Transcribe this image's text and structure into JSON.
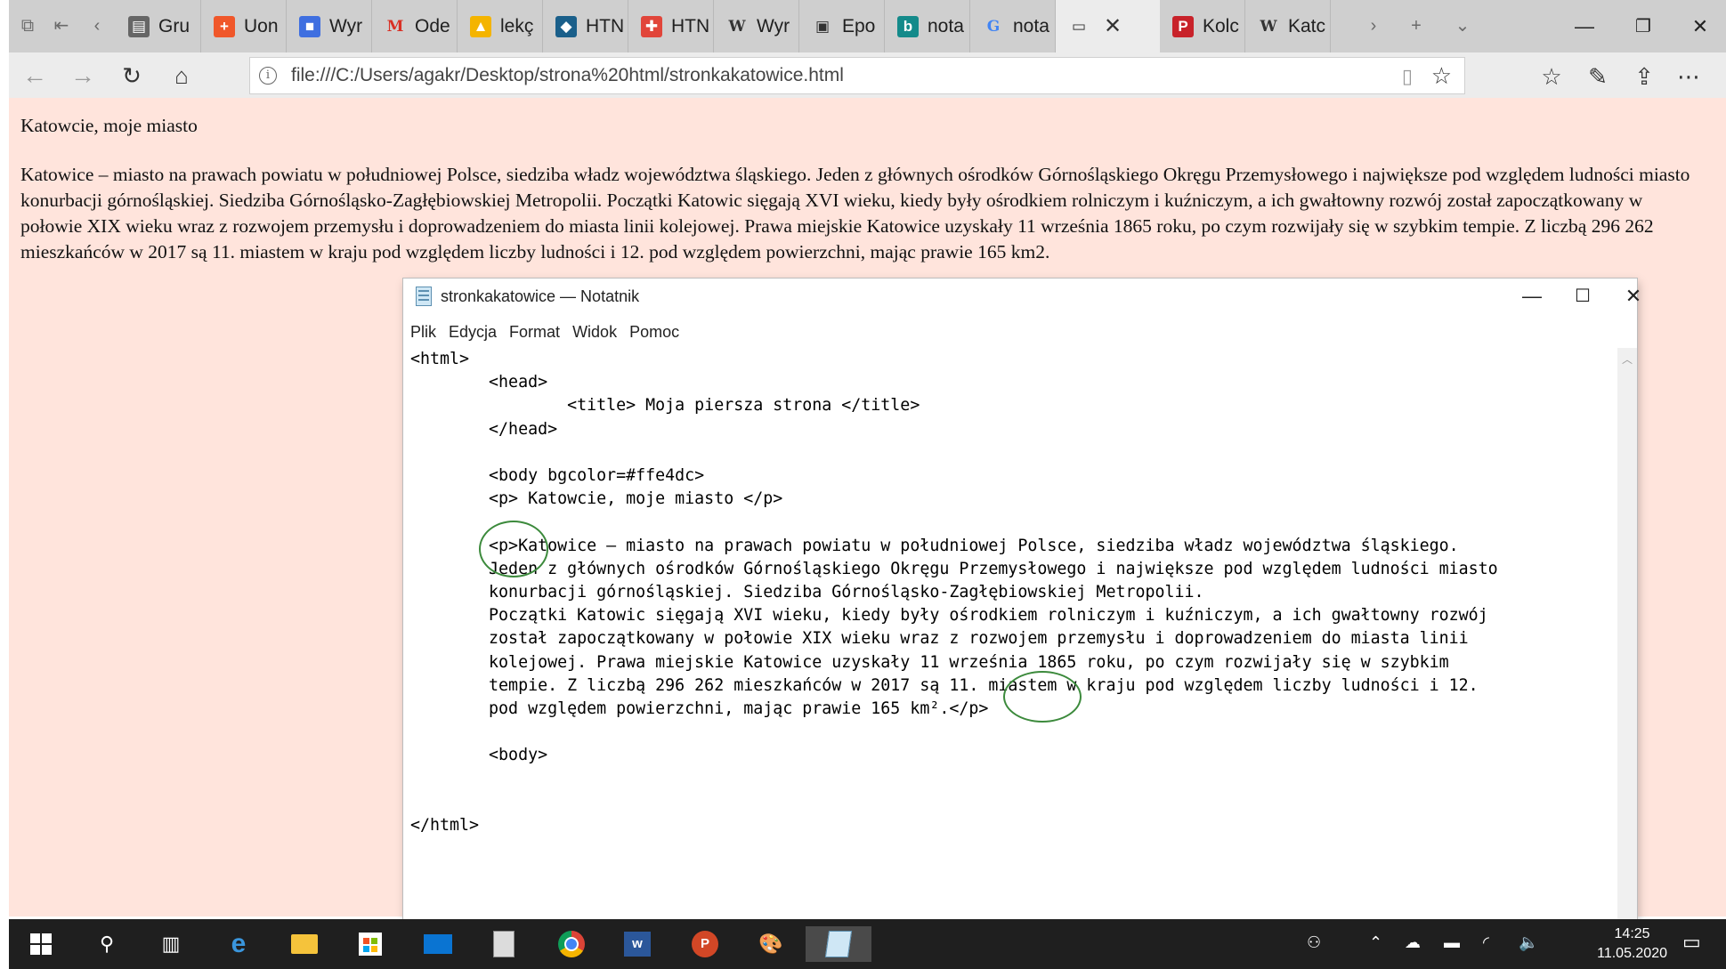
{
  "browser": {
    "tabs": [
      {
        "title": "Gru",
        "icon": "group-icon",
        "color": "#666666"
      },
      {
        "title": "Uon",
        "icon": "plus-square-icon",
        "color": "#f0572a"
      },
      {
        "title": "Wyr",
        "icon": "contacts-icon",
        "color": "#3f6fe0"
      },
      {
        "title": "Ode",
        "icon": "gmail-icon",
        "color": "#d93025"
      },
      {
        "title": "lekç",
        "icon": "drive-icon",
        "color": "#f4b400"
      },
      {
        "title": "HTN",
        "icon": "graduation-cap-icon",
        "color": "#1a5f8a"
      },
      {
        "title": "HTN",
        "icon": "puzzle-icon",
        "color": "#e1453a"
      },
      {
        "title": "Wyr",
        "icon": "wikipedia-icon",
        "color": "#333333"
      },
      {
        "title": "Epo",
        "icon": "bookmark-icon",
        "color": "#333333"
      },
      {
        "title": "nota",
        "icon": "bing-icon",
        "color": "#148a8a"
      },
      {
        "title": "nota",
        "icon": "google-icon",
        "color": "#4285f4"
      },
      {
        "title": "",
        "icon": "window-icon",
        "color": "#333333",
        "active": true
      },
      {
        "title": "Kolc",
        "icon": "pdf-icon",
        "color": "#c8222a"
      },
      {
        "title": "Katc",
        "icon": "wikipedia-icon",
        "color": "#333333"
      }
    ],
    "url": "file:///C:/Users/agakr/Desktop/strona%20html/stronkakatowice.html"
  },
  "page": {
    "title_text": "Katowcie, moje miasto",
    "body_text": "Katowice – miasto na prawach powiatu w południowej Polsce, siedziba władz województwa śląskiego. Jeden z głównych ośrodków Górnośląskiego Okręgu Przemysłowego i największe pod względem ludności miasto konurbacji górnośląskiej. Siedziba Górnośląsko-Zagłębiowskiej Metropolii. Początki Katowic sięgają XVI wieku, kiedy były ośrodkiem rolniczym i kuźniczym, a ich gwałtowny rozwój został zapoczątkowany w połowie XIX wieku wraz z rozwojem przemysłu i doprowadzeniem do miasta linii kolejowej. Prawa miejskie Katowice uzyskały 11 września 1865 roku, po czym rozwijały się w szybkim tempie. Z liczbą 296 262 mieszkańców w 2017 są 11. miastem w kraju pod względem liczby ludności i 12. pod względem powierzchni, mając prawie 165 km2.",
    "background": "#ffe4dc"
  },
  "notepad": {
    "title": "stronkakatowice — Notatnik",
    "menu": [
      "Plik",
      "Edycja",
      "Format",
      "Widok",
      "Pomoc"
    ],
    "lines": [
      "<html>",
      "        <head>",
      "                <title> Moja piersza strona </title>",
      "        </head>",
      "",
      "        <body bgcolor=#ffe4dc>",
      "        <p> Katowcie, moje miasto </p>",
      "",
      "        <p>Katowice – miasto na prawach powiatu w południowej Polsce, siedziba władz województwa śląskiego.",
      "        Jeden z głównych ośrodków Górnośląskiego Okręgu Przemysłowego i największe pod względem ludności miasto",
      "        konurbacji górnośląskiej. Siedziba Górnośląsko-Zagłębiowskiej Metropolii.",
      "        Początki Katowic sięgają XVI wieku, kiedy były ośrodkiem rolniczym i kuźniczym, a ich gwałtowny rozwój",
      "        został zapoczątkowany w połowie XIX wieku wraz z rozwojem przemysłu i doprowadzeniem do miasta linii",
      "        kolejowej. Prawa miejskie Katowice uzyskały 11 września 1865 roku, po czym rozwijały się w szybkim",
      "        tempie. Z liczbą 296 262 mieszkańców w 2017 są 11. miastem w kraju pod względem liczby ludności i 12.",
      "        pod względem powierzchni, mając prawie 165 km².</p>",
      "",
      "        <body>",
      "",
      "",
      "</html>"
    ]
  },
  "taskbar": {
    "apps": [
      "windows-start-icon",
      "search-icon",
      "task-view-icon",
      "edge-icon",
      "file-explorer-icon",
      "store-icon",
      "mail-icon",
      "calculator-icon",
      "chrome-icon",
      "word-icon",
      "powerpoint-icon",
      "paint-icon",
      "notepad-icon"
    ],
    "time": "14:25",
    "date": "11.05.2020"
  }
}
